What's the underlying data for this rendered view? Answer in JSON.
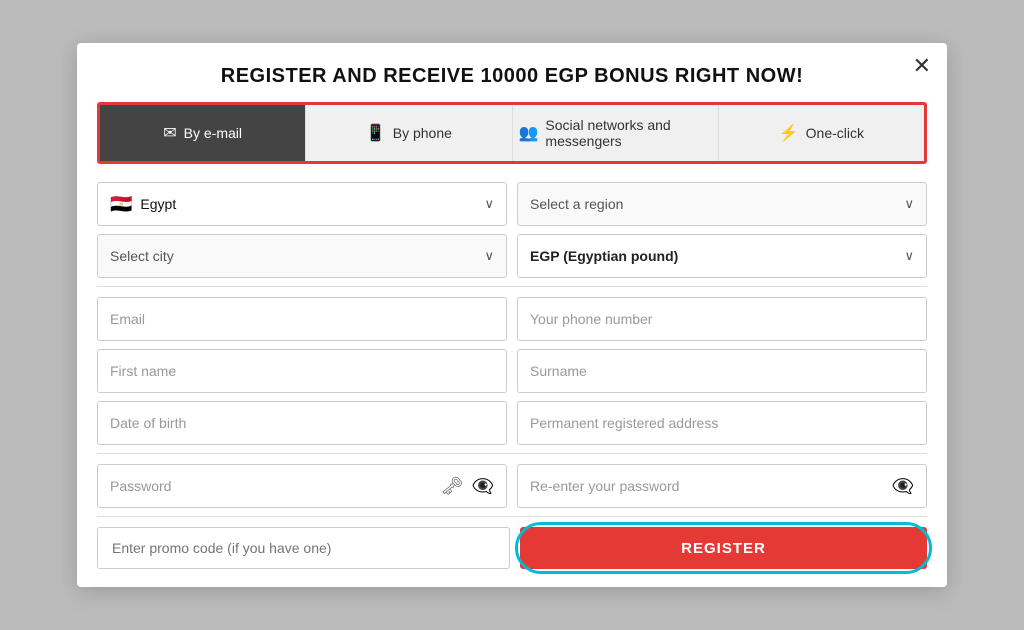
{
  "modal": {
    "title": "REGISTER AND RECEIVE 10000 EGP BONUS RIGHT NOW!",
    "close_label": "✕"
  },
  "tabs": [
    {
      "id": "email",
      "label": "By e-mail",
      "icon": "✉",
      "active": true
    },
    {
      "id": "phone",
      "label": "By phone",
      "icon": "📱",
      "active": false
    },
    {
      "id": "social",
      "label": "Social networks and messengers",
      "icon": "👥",
      "active": false
    },
    {
      "id": "oneclick",
      "label": "One-click",
      "icon": "⚡",
      "active": false
    }
  ],
  "form": {
    "country_label": "Egypt",
    "country_flag": "🇪🇬",
    "region_placeholder": "Select a region",
    "city_placeholder": "Select city",
    "currency_label": "EGP (Egyptian pound)",
    "email_placeholder": "Email",
    "phone_placeholder": "Your phone number",
    "firstname_placeholder": "First name",
    "surname_placeholder": "Surname",
    "dob_placeholder": "Date of birth",
    "address_placeholder": "Permanent registered address",
    "password_placeholder": "Password",
    "repassword_placeholder": "Re-enter your password",
    "promo_placeholder": "Enter promo code (if you have one)",
    "register_label": "REGISTER"
  }
}
